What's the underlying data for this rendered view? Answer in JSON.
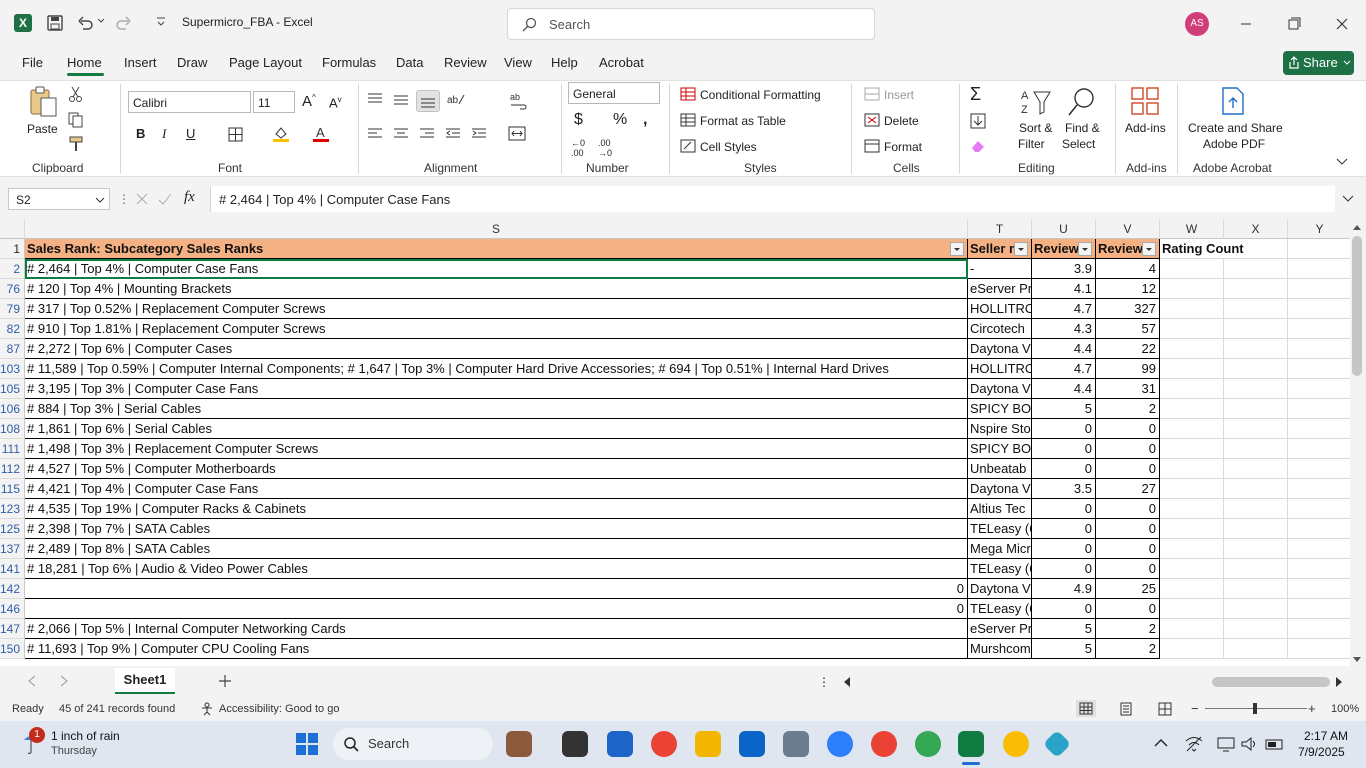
{
  "window": {
    "title": "Supermicro_FBA  -  Excel",
    "search_placeholder": "Search",
    "user_initials": "AS"
  },
  "menu": [
    "File",
    "Home",
    "Insert",
    "Draw",
    "Page Layout",
    "Formulas",
    "Data",
    "Review",
    "View",
    "Help",
    "Acrobat"
  ],
  "share_label": "Share",
  "ribbon": {
    "paste": "Paste",
    "font_name": "Calibri",
    "font_size": "11",
    "number_format": "General",
    "conditional_formatting": "Conditional Formatting",
    "format_as_table": "Format as Table",
    "cell_styles": "Cell Styles",
    "insert": "Insert",
    "delete": "Delete",
    "format": "Format",
    "sort_filter_1": "Sort &",
    "sort_filter_2": "Filter",
    "find_select_1": "Find &",
    "find_select_2": "Select",
    "addins": "Add-ins",
    "create_share_1": "Create and Share",
    "create_share_2": "Adobe PDF",
    "groups": {
      "clipboard": "Clipboard",
      "font": "Font",
      "alignment": "Alignment",
      "number": "Number",
      "styles": "Styles",
      "cells": "Cells",
      "editing": "Editing",
      "addins": "Add-ins",
      "adobe": "Adobe Acrobat"
    }
  },
  "formula_bar": {
    "name_box": "S2",
    "fx": "fx",
    "content": "# 2,464 | Top 4% | Computer Case Fans"
  },
  "columns": [
    "S",
    "T",
    "U",
    "V",
    "W",
    "X",
    "Y"
  ],
  "header_row": {
    "row": "1",
    "S": "Sales Rank: Subcategory Sales Ranks",
    "T": "Seller n",
    "U": "Review",
    "V": "Review",
    "W": "Rating Count"
  },
  "rows": [
    {
      "row": "2",
      "S": "# 2,464 | Top 4% | Computer Case Fans",
      "T": "-",
      "U": "3.9",
      "V": "4"
    },
    {
      "row": "76",
      "S": "# 120 | Top 4% | Mounting Brackets",
      "T": "eServer Pr",
      "U": "4.1",
      "V": "12"
    },
    {
      "row": "79",
      "S": "# 317 | Top 0.52% | Replacement Computer Screws",
      "T": "HOLLITRO",
      "U": "4.7",
      "V": "327"
    },
    {
      "row": "82",
      "S": "# 910 | Top 1.81% | Replacement Computer Screws",
      "T": "Circotech",
      "U": "4.3",
      "V": "57"
    },
    {
      "row": "87",
      "S": "# 2,272 | Top 6% | Computer Cases",
      "T": "Daytona V",
      "U": "4.4",
      "V": "22"
    },
    {
      "row": "103",
      "S": "# 11,589 | Top 0.59% | Computer Internal Components; # 1,647 | Top 3% | Computer Hard Drive Accessories; # 694 | Top 0.51% | Internal Hard Drives",
      "T": "HOLLITRO",
      "U": "4.7",
      "V": "99"
    },
    {
      "row": "105",
      "S": "# 3,195 | Top 3% | Computer Case Fans",
      "T": "Daytona V",
      "U": "4.4",
      "V": "31"
    },
    {
      "row": "106",
      "S": "# 884 | Top 3% | Serial Cables",
      "T": "SPICY BON",
      "U": "5",
      "V": "2"
    },
    {
      "row": "108",
      "S": "# 1,861 | Top 6% | Serial Cables",
      "T": "Nspire Sto",
      "U": "0",
      "V": "0"
    },
    {
      "row": "111",
      "S": "# 1,498 | Top 3% | Replacement Computer Screws",
      "T": "SPICY BON",
      "U": "0",
      "V": "0"
    },
    {
      "row": "112",
      "S": "# 4,527 | Top 5% | Computer Motherboards",
      "T": "Unbeatab",
      "U": "0",
      "V": "0"
    },
    {
      "row": "115",
      "S": "# 4,421 | Top 4% | Computer Case Fans",
      "T": "Daytona V",
      "U": "3.5",
      "V": "27"
    },
    {
      "row": "123",
      "S": "# 4,535 | Top 19% | Computer Racks & Cabinets",
      "T": "Altius Tec",
      "U": "0",
      "V": "0"
    },
    {
      "row": "125",
      "S": "# 2,398 | Top 7% | SATA Cables",
      "T": "TELeasy (6",
      "U": "0",
      "V": "0"
    },
    {
      "row": "137",
      "S": "# 2,489 | Top 8% | SATA Cables",
      "T": "Mega Micr",
      "U": "0",
      "V": "0"
    },
    {
      "row": "141",
      "S": "# 18,281 | Top 6% | Audio & Video Power Cables",
      "T": "TELeasy (6",
      "U": "0",
      "V": "0"
    },
    {
      "row": "142",
      "S": "0",
      "T": "Daytona V",
      "U": "4.9",
      "V": "25"
    },
    {
      "row": "146",
      "S": "0",
      "T": "TELeasy (6",
      "U": "0",
      "V": "0"
    },
    {
      "row": "147",
      "S": "# 2,066 | Top 5% | Internal Computer Networking Cards",
      "T": "eServer Pr",
      "U": "5",
      "V": "2"
    },
    {
      "row": "150",
      "S": "# 11,693 | Top 9% | Computer CPU Cooling Fans",
      "T": "Murshcom",
      "U": "5",
      "V": "2"
    }
  ],
  "sheet_tab": "Sheet1",
  "status": {
    "ready": "Ready",
    "records": "45 of 241 records found",
    "accessibility": "Accessibility: Good to go",
    "zoom": "100%"
  },
  "taskbar": {
    "weather_temp": "1 inch of rain",
    "weather_day": "Thursday",
    "weather_badge": "1",
    "search": "Search",
    "time": "2:17 AM",
    "date": "7/9/2025"
  },
  "colors": {
    "accent": "#107c41",
    "header_fill": "#f4b183",
    "share": "#1e7145"
  }
}
